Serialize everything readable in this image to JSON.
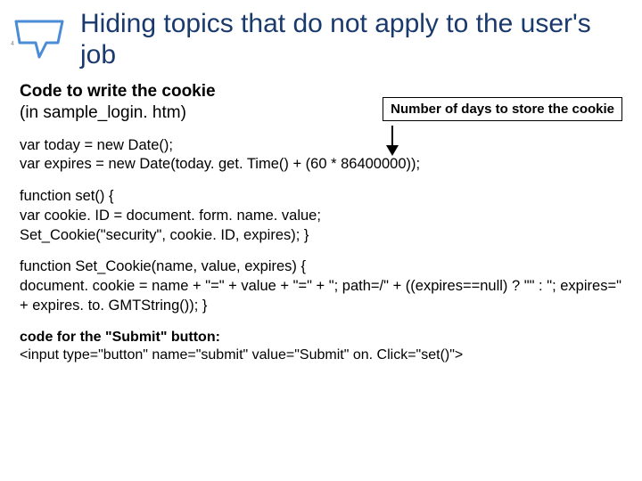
{
  "pageNumber": "4",
  "title": "Hiding topics that do not apply to the user's job",
  "subhead": {
    "bold": "Code to write the cookie",
    "plain": "(in sample_login. htm)"
  },
  "callout": "Number of days to store the cookie",
  "code1a": "var today = new Date();",
  "code1b": "var expires = new Date(today. get. Time() + (60 * 86400000));",
  "code2a": "function set() {",
  "code2b": "var cookie. ID = document. form. name. value;",
  "code2c": "Set_Cookie(\"security\", cookie. ID, expires); }",
  "code3a": "function Set_Cookie(name, value, expires) {",
  "code3b": "document. cookie = name + \"=\" + value + \"=\" + \"; path=/\" + ((expires==null) ? \"\" : \"; expires=\" + expires. to. GMTString()); }",
  "footer": {
    "bold": "code for the \"Submit\" button:",
    "plain": "<input type=\"button\" name=\"submit\" value=\"Submit\" on. Click=\"set()\">"
  }
}
